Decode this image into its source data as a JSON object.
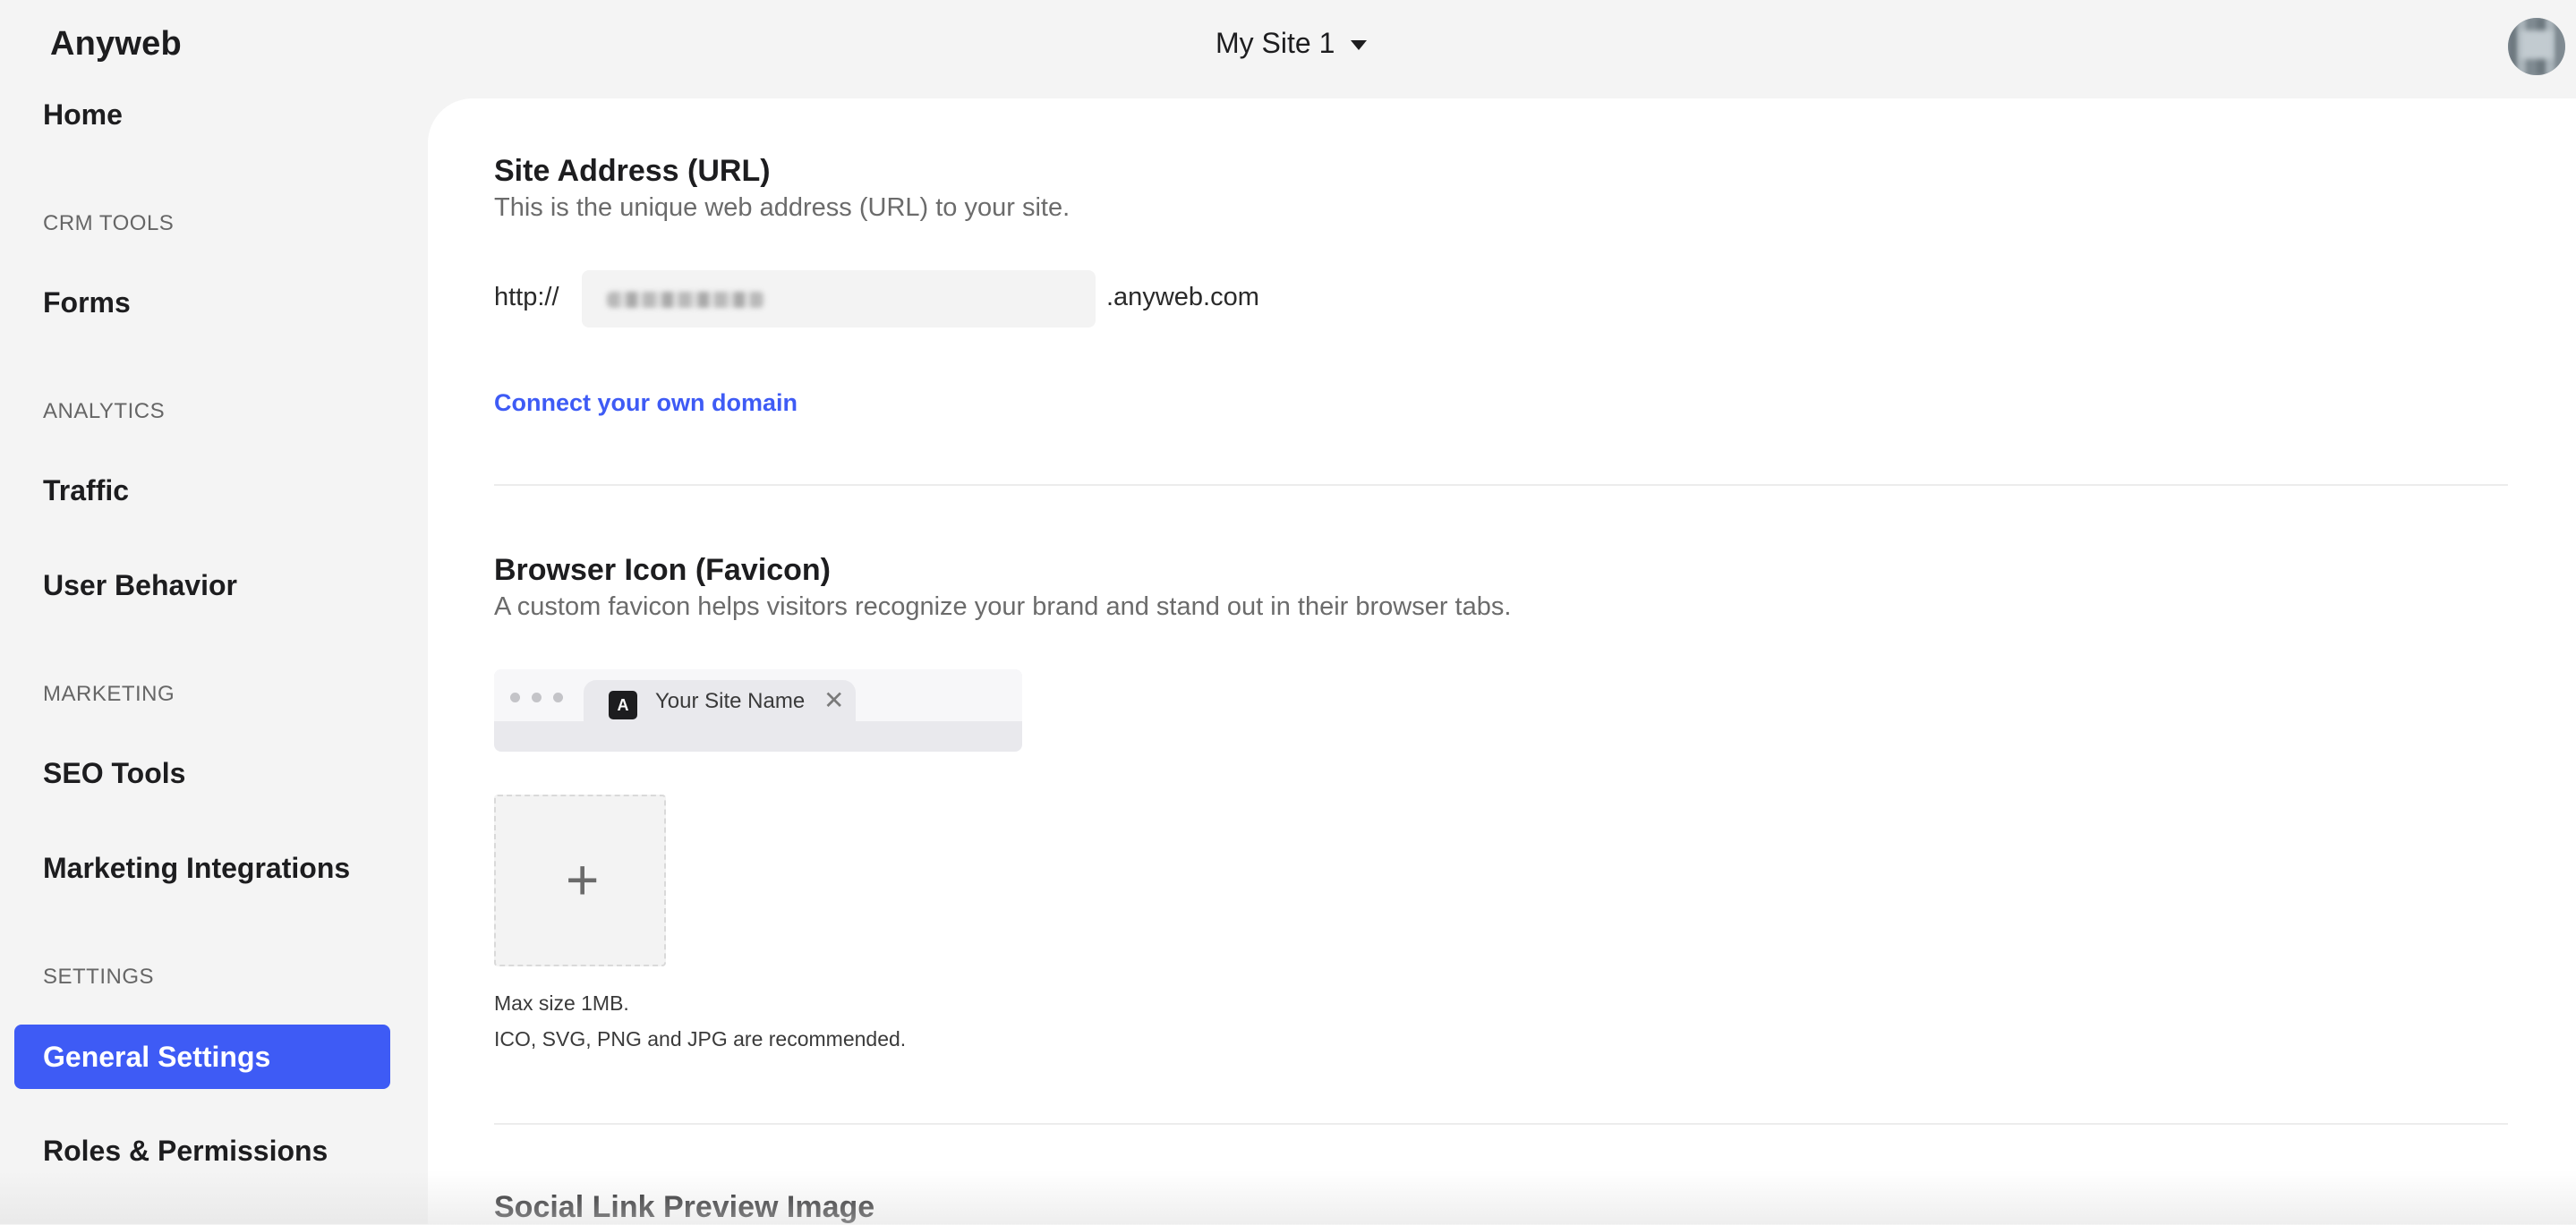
{
  "app": {
    "brand": "Anyweb"
  },
  "header": {
    "site_selector": "My Site 1"
  },
  "sidebar": {
    "home": "Home",
    "sections": {
      "crm": "CRM TOOLS",
      "analytics": "ANALYTICS",
      "marketing": "MARKETING",
      "settings": "SETTINGS"
    },
    "items": {
      "forms": "Forms",
      "traffic": "Traffic",
      "user_behavior": "User Behavior",
      "seo_tools": "SEO Tools",
      "marketing_integrations": "Marketing Integrations",
      "general_settings": "General Settings",
      "roles_permissions": "Roles & Permissions"
    },
    "active": "General Settings"
  },
  "site_address": {
    "title": "Site Address (URL)",
    "description": "This is the unique web address (URL) to your site.",
    "prefix": "http://",
    "suffix": ".anyweb.com",
    "connect_link": "Connect your own domain"
  },
  "favicon": {
    "title": "Browser Icon (Favicon)",
    "description": "A custom favicon helps visitors recognize your brand and stand out in their browser tabs.",
    "preview_icon_letter": "A",
    "preview_tab_title": "Your Site Name",
    "upload_symbol": "+",
    "note_size": "Max size 1MB.",
    "note_formats": "ICO, SVG, PNG and JPG are recommended."
  },
  "social": {
    "title": "Social Link Preview Image"
  },
  "colors": {
    "accent": "#3e5bf5",
    "background": "#f4f4f4",
    "panel": "#ffffff"
  }
}
